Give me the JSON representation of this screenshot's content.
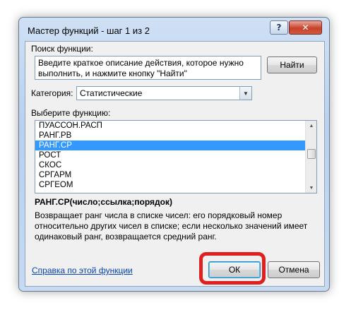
{
  "window": {
    "title": "Мастер функций - шаг 1 из 2",
    "help_glyph": "?",
    "close_glyph": "✕"
  },
  "search": {
    "label": "Поиск функции:",
    "description": "Введите краткое описание действия, которое нужно выполнить, и нажмите кнопку \"Найти\"",
    "find_button": "Найти"
  },
  "category": {
    "label": "Категория:",
    "selected": "Статистические"
  },
  "function_list": {
    "label": "Выберите функцию:",
    "items": [
      "ПУАССОН.РАСП",
      "РАНГ.РВ",
      "РАНГ.СР",
      "РОСТ",
      "СКОС",
      "СРГАРМ",
      "СРГЕОМ"
    ],
    "selected_index": 2
  },
  "function_info": {
    "syntax": "РАНГ.СР(число;ссылка;порядок)",
    "description": "Возвращает ранг числа в списке чисел: его порядковый номер относительно других чисел в списке; если несколько значений имеет одинаковый ранг, возвращается средний ранг."
  },
  "footer": {
    "help_link": "Справка по этой функции",
    "ok_button": "ОК",
    "cancel_button": "Отмена"
  },
  "colors": {
    "selection": "#3399ff",
    "highlight": "#e02020",
    "link": "#0645ad"
  }
}
